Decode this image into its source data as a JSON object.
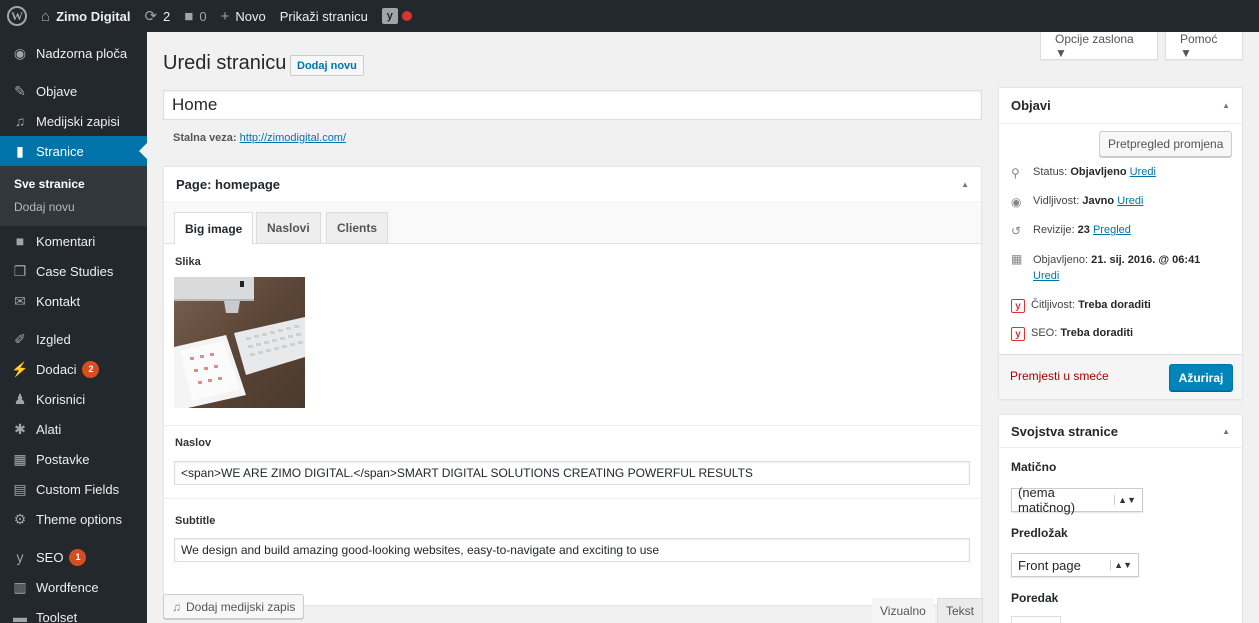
{
  "adminbar": {
    "site_name": "Zimo Digital",
    "updates_count": "2",
    "comments_count": "0",
    "new_label": "Novo",
    "view_page_label": "Prikaži stranicu"
  },
  "sidebar": {
    "items": [
      {
        "label": "Nadzorna ploča",
        "icon": "dashboard-icon"
      },
      {
        "label": "Objave",
        "icon": "pin-icon"
      },
      {
        "label": "Medijski zapisi",
        "icon": "media-icon"
      },
      {
        "label": "Stranice",
        "icon": "pages-icon"
      },
      {
        "label": "Komentari",
        "icon": "comment-icon"
      },
      {
        "label": "Case Studies",
        "icon": "case-studies-icon"
      },
      {
        "label": "Kontakt",
        "icon": "mail-icon"
      },
      {
        "label": "Izgled",
        "icon": "appearance-icon"
      },
      {
        "label": "Dodaci",
        "icon": "plugins-icon",
        "badge": "2"
      },
      {
        "label": "Korisnici",
        "icon": "users-icon"
      },
      {
        "label": "Alati",
        "icon": "tools-icon"
      },
      {
        "label": "Postavke",
        "icon": "settings-icon"
      },
      {
        "label": "Custom Fields",
        "icon": "custom-fields-icon"
      },
      {
        "label": "Theme options",
        "icon": "gear-icon"
      },
      {
        "label": "SEO",
        "icon": "yoast-icon",
        "badge": "1"
      },
      {
        "label": "Wordfence",
        "icon": "wordfence-icon"
      },
      {
        "label": "Toolset",
        "icon": "toolset-icon"
      }
    ],
    "submenu": [
      "Sve stranice",
      "Dodaj novu"
    ]
  },
  "screen_meta": {
    "options_label": "Opcije zaslona ▼",
    "help_label": "Pomoć ▼"
  },
  "main": {
    "title": "Uredi stranicu",
    "add_new_label": "Dodaj novu",
    "post_title": "Home",
    "permalink_label": "Stalna veza:",
    "permalink_url": "http://zimodigital.com/"
  },
  "acf": {
    "box_title": "Page: homepage",
    "tabs": [
      "Big image",
      "Naslovi",
      "Clients"
    ],
    "image_label": "Slika",
    "naslov_label": "Naslov",
    "naslov_value": "<span>WE ARE ZIMO DIGITAL.</span>SMART DIGITAL SOLUTIONS CREATING POWERFUL RESULTS",
    "subtitle_label": "Subtitle",
    "subtitle_value": "We design and build amazing good-looking websites, easy-to-navigate and exciting to use"
  },
  "editor": {
    "add_media_label": "Dodaj medijski zapis",
    "visual_tab": "Vizualno",
    "text_tab": "Tekst"
  },
  "publish": {
    "title": "Objavi",
    "preview_label": "Pretpregled promjena",
    "status_label": "Status:",
    "status_value": "Objavljeno",
    "visibility_label": "Vidljivost:",
    "visibility_value": "Javno",
    "revisions_label": "Revizije:",
    "revisions_value": "23",
    "revisions_link": "Pregled",
    "published_label": "Objavljeno:",
    "published_value": "21. sij. 2016. @ 06:41",
    "edit_link": "Uredi",
    "readability_label": "Čitljivost:",
    "readability_value": "Treba doraditi",
    "seo_label": "SEO:",
    "seo_value": "Treba doraditi",
    "trash_label": "Premjesti u smeće",
    "update_label": "Ažuriraj"
  },
  "attributes": {
    "title": "Svojstva stranice",
    "parent_label": "Matično",
    "parent_value": "(nema matičnog)",
    "template_label": "Predložak",
    "template_value": "Front page",
    "order_label": "Poredak"
  },
  "colors": {
    "accent": "#0073aa",
    "primary_button": "#0085ba",
    "adminbar_bg": "#23282d",
    "badge": "#d54e21",
    "danger": "#dc3232"
  }
}
